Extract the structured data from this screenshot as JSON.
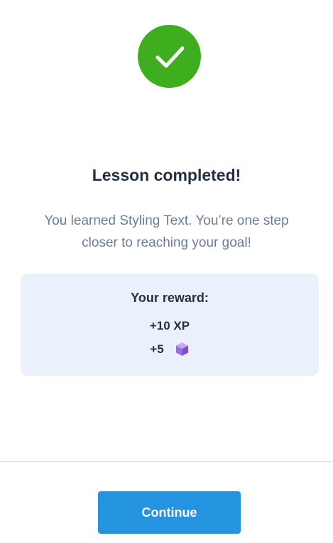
{
  "success_icon": "checkmark-circle-icon",
  "title": "Lesson completed!",
  "subtitle": "You learned Styling Text. You’re one step closer to reaching your goal!",
  "reward": {
    "heading": "Your reward:",
    "xp": "+10 XP",
    "gems": "+5",
    "gem_icon": "gem-cube-icon"
  },
  "continue_label": "Continue",
  "colors": {
    "success": "#3fae1e",
    "title": "#253140",
    "subtitle": "#6b7d95",
    "card_bg": "#eaf1fc",
    "button": "#2594e0",
    "gem": "#9b6ee0"
  }
}
